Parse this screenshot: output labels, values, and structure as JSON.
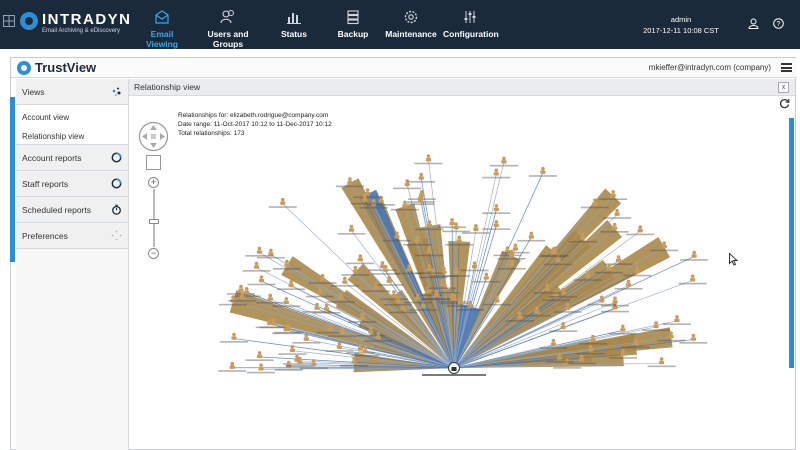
{
  "brand": {
    "name": "INTRADYN",
    "tagline": "Email Archiving & eDiscovery"
  },
  "nav": [
    {
      "label": "Email Viewing",
      "icon": "envelope-icon",
      "active": true
    },
    {
      "label": "Users and Groups",
      "icon": "users-icon",
      "active": false
    },
    {
      "label": "Status",
      "icon": "bar-chart-icon",
      "active": false
    },
    {
      "label": "Backup",
      "icon": "database-icon",
      "active": false
    },
    {
      "label": "Maintenance",
      "icon": "gear-icon",
      "active": false
    },
    {
      "label": "Configuration",
      "icon": "sliders-icon",
      "active": false
    }
  ],
  "user": {
    "name": "admin",
    "datetime": "2017-12-11 10:08 CST"
  },
  "app": {
    "title": "TrustView",
    "account": "mkieffer@intradyn.com (company)"
  },
  "sidebar": {
    "views_label": "Views",
    "views_items": [
      "Account view",
      "Relationship view"
    ],
    "sections": [
      "Account reports",
      "Staff reports",
      "Scheduled reports",
      "Preferences"
    ]
  },
  "view": {
    "title": "Relationship view",
    "close": "x",
    "relationships_for": "Relationships for: elizabeth.rodrigue@company.com",
    "date_range": "Date range: 11-Oct-2017 10:12 to 11-Dec-2017 10:12",
    "total": "Total relationships: 173"
  },
  "colors": {
    "nav_bg": "#1b2a3b",
    "accent": "#2a8fd6",
    "active_nav": "#39a7ea",
    "edge_gold": "#a8874a",
    "edge_blue": "#4a76b0",
    "node_icon": "#c99a5a"
  }
}
